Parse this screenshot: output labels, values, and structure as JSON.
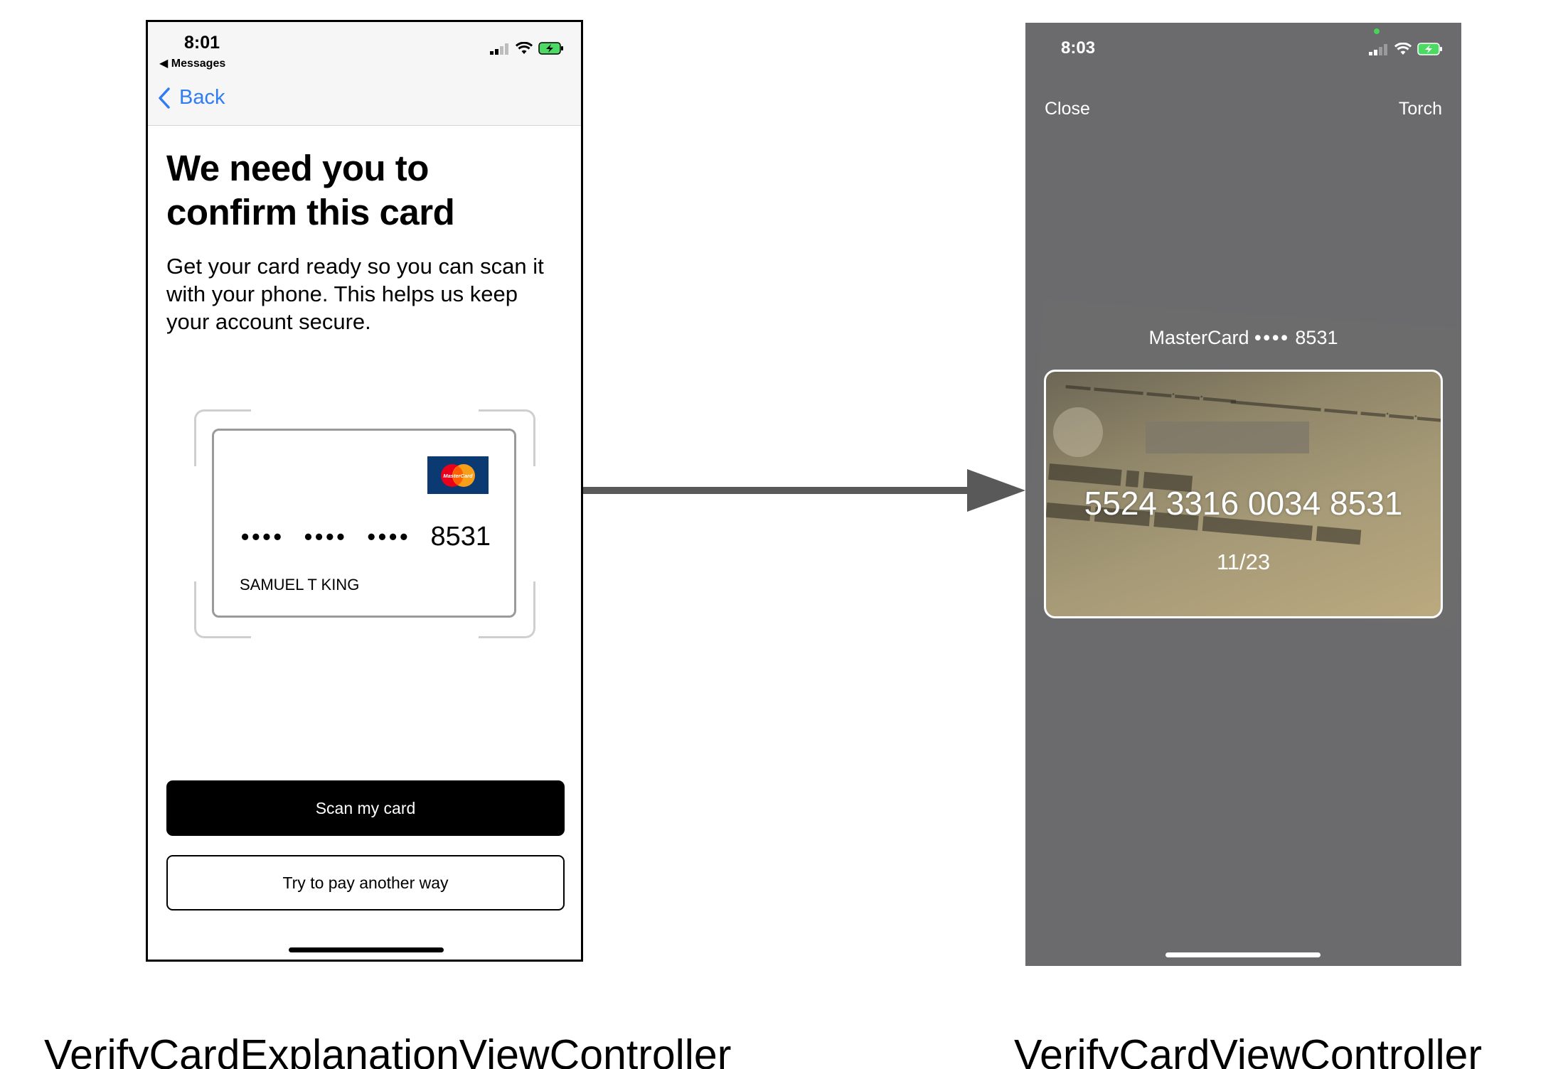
{
  "left_screen": {
    "status_bar": {
      "time": "8:01",
      "back_app": "◀ Messages"
    },
    "nav": {
      "back_label": "Back"
    },
    "title": "We need you to confirm this card",
    "body": "Get your card ready so you can scan it with your phone. This helps us keep your account secure.",
    "card": {
      "brand_logo_text": "MasterCard",
      "masked_groups": [
        "••••",
        "••••",
        "••••"
      ],
      "last4": "8531",
      "cardholder": "SAMUEL T KING"
    },
    "primary_button": "Scan my card",
    "secondary_button": "Try to pay another way"
  },
  "right_screen": {
    "status_bar": {
      "time": "8:03"
    },
    "close_label": "Close",
    "torch_label": "Torch",
    "card_description": {
      "brand": "MasterCard",
      "dots": "••••",
      "last4": "8531"
    },
    "detected_number": "5524 3316 0034 8531",
    "detected_expiry": "11/23"
  },
  "captions": {
    "left": "VerifyCardExplanationViewController",
    "right": "VerifyCardViewController"
  },
  "colors": {
    "link_blue": "#2f7cf6",
    "camera_overlay": "#6b6a6c",
    "mastercard_blue": "#0b3a73",
    "mastercard_red": "#eb001b",
    "mastercard_orange": "#f79e1b",
    "arrow": "#595959"
  }
}
